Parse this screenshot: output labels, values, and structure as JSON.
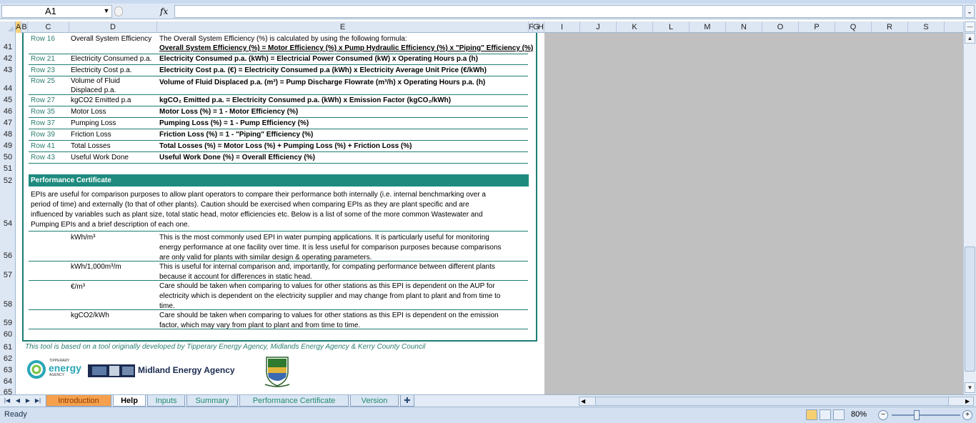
{
  "formula_bar": {
    "name_box": "A1",
    "fx_label": "fx",
    "formula": ""
  },
  "columns": [
    "A",
    "B",
    "C",
    "D",
    "E",
    "F",
    "G",
    "H",
    "I",
    "J",
    "K",
    "L",
    "M",
    "N",
    "O",
    "P",
    "Q",
    "R",
    "S"
  ],
  "rows": [
    "41",
    "42",
    "43",
    "44",
    "45",
    "46",
    "47",
    "48",
    "49",
    "50",
    "51",
    "52",
    "54",
    "56",
    "57",
    "58",
    "59",
    "60",
    "61",
    "62",
    "63",
    "64",
    "65"
  ],
  "formula_table": [
    {
      "ref": "Row 16",
      "item": "Overall System Efficiency",
      "desc1": "The Overall System Efficiency (%) is calculated by using the following formula:",
      "desc2": "Overall System Efficiency (%) = Motor Efficiency (%) x Pump Hydraulic Efficiency (%) x \"Piping\" Efficiency (%)"
    },
    {
      "ref": "Row 21",
      "item": "Electricity Consumed p.a.",
      "desc1": "Electricity Consumed p.a. (kWh) = Electricial Power Consumed (kW) x Operating Hours p.a (h)"
    },
    {
      "ref": "Row 23",
      "item": "Electricity Cost p.a.",
      "desc1": "Electricity Cost p.a. (€) = Electricity Consumed p.a (kWh) x Electricity Average Unit Price (€/kWh)"
    },
    {
      "ref": "Row 25",
      "item": "Volume of Fluid",
      "item2": "Displaced p.a.",
      "desc1": "Volume of Fluid Displaced p.a. (m³) = Pump Discharge Flowrate (m³/h) x Operating Hours p.a. (h)"
    },
    {
      "ref": "Row 27",
      "item": "kgCO2 Emitted p.a",
      "desc1": "kgCO₂ Emitted p.a. = Electricity Consumed p.a. (kWh) x Emission Factor (kgCO₂/kWh)"
    },
    {
      "ref": "Row 35",
      "item": "Motor Loss",
      "desc1": "Motor Loss (%) = 1 - Motor Efficiency (%)"
    },
    {
      "ref": "Row 37",
      "item": "Pumping Loss",
      "desc1": "Pumping Loss (%) = 1 - Pump Efficiency (%)"
    },
    {
      "ref": "Row 39",
      "item": "Friction Loss",
      "desc1": "Friction Loss (%) = 1 - \"Piping\" Efficiency (%)"
    },
    {
      "ref": "Row 41",
      "item": "Total Losses",
      "desc1": "Total Losses (%) = Motor Loss (%) + Pumping Loss (%)  + Friction Loss (%)"
    },
    {
      "ref": "Row 43",
      "item": "Useful Work Done",
      "desc1": "Useful Work Done (%) = Overall Efficiency (%)"
    }
  ],
  "performance": {
    "header": "Performance Certificate",
    "intro": [
      "EPIs are useful for comparison purposes to allow plant operators to compare their performance both internally (i.e. internal benchmarking over a",
      "period of time) and externally (to that of other plants).  Caution should be exercised when comparing EPIs as they are plant specific and are",
      "influenced by variables such as plant size, total static head, motor efficiencies etc.  Below is a list of some of the more common Wastewater and",
      "Pumping EPIs and a brief description of each one."
    ],
    "epis": [
      {
        "name": "kWh/m³",
        "lines": [
          "This is the most commonly used EPI in water pumping applications.  It is particularly useful for monitoring",
          "energy performance at one facility over time.  It is less useful for comparison purposes because comparisons",
          "are only valid for plants with similar design & operating parameters."
        ]
      },
      {
        "name": "kWh/1,000m³/m",
        "lines": [
          "This is useful for internal comparison and, importantly, for compating performance between different plants",
          "because it account for differences in static head."
        ]
      },
      {
        "name": "€/m³",
        "lines": [
          "Care should be taken when comparing to values for other stations as this EPI is dependent on the AUP for",
          "electricity which is dependent on the electricity supplier and may change from plant to plant and from time to",
          "time."
        ]
      },
      {
        "name": "kgCO2/kWh",
        "lines": [
          "Care should be taken when comparing to values for other stations as this EPI is dependent on the emission",
          "factor, which may vary from plant to plant and from time to time."
        ]
      }
    ]
  },
  "footnote": "This tool is based on a tool originally developed by Tipperary Energy Agency, Midlands Energy Agency & Kerry County Council",
  "logos": {
    "energy_small": "TIPPERARY",
    "energy_big": "energy",
    "energy_sub": "AGENCY",
    "mea": "Midland Energy Agency"
  },
  "tabs": [
    "Introduction",
    "Help",
    "Inputs",
    "Summary",
    "Performance Certificate",
    "Version"
  ],
  "status": {
    "text": "Ready",
    "zoom": "80%"
  },
  "colors": {
    "teal": "#1e7d74",
    "tab_orange": "#f6a04d"
  }
}
